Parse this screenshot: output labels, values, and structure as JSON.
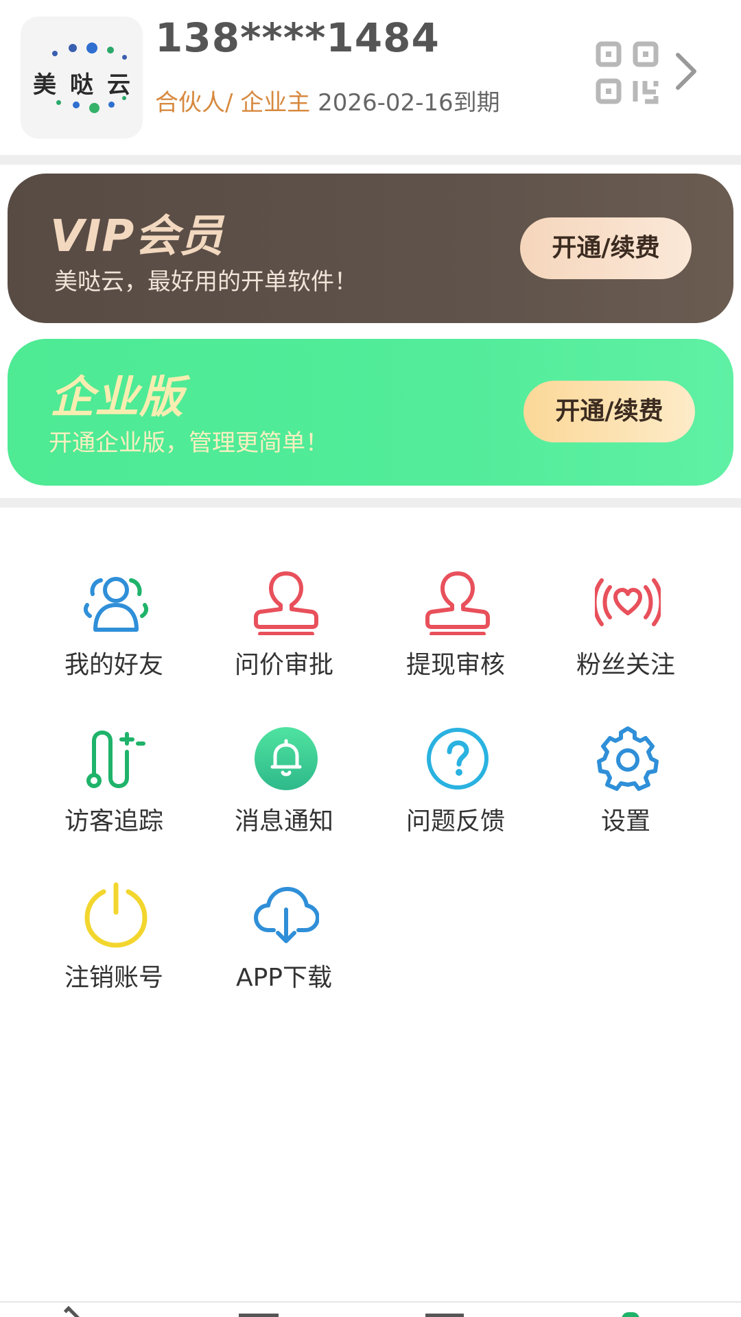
{
  "profile": {
    "logo_chars": [
      "美",
      "哒",
      "云"
    ],
    "phone": "138****1484",
    "role": "合伙人/ 企业主",
    "expire": "2026-02-16到期",
    "qr_icon": "qr-code-icon",
    "chevron_icon": "chevron-right-icon"
  },
  "banners": {
    "vip": {
      "title": "VIP会员",
      "subtitle": "美哒云，最好用的开单软件！",
      "button": "开通/续费"
    },
    "enterprise": {
      "title": "企业版",
      "subtitle": "开通企业版，管理更简单！",
      "button": "开通/续费"
    }
  },
  "menu": [
    {
      "label": "我的好友",
      "icon": "friends-icon",
      "color": "#2f8fd8"
    },
    {
      "label": "问价审批",
      "icon": "person-stamp-icon",
      "color": "#e8505b"
    },
    {
      "label": "提现审核",
      "icon": "person-stamp-icon",
      "color": "#e8505b"
    },
    {
      "label": "粉丝关注",
      "icon": "heart-signal-icon",
      "color": "#e8505b"
    },
    {
      "label": "访客追踪",
      "icon": "route-icon",
      "color": "#1fb36a"
    },
    {
      "label": "消息通知",
      "icon": "bell-icon",
      "color": "#3fcf90"
    },
    {
      "label": "问题反馈",
      "icon": "question-icon",
      "color": "#2ab2e0"
    },
    {
      "label": "设置",
      "icon": "gear-icon",
      "color": "#2f8fd8"
    },
    {
      "label": "注销账号",
      "icon": "power-icon",
      "color": "#f2d62e"
    },
    {
      "label": "APP下载",
      "icon": "cloud-download-icon",
      "color": "#2f8fd8"
    }
  ]
}
